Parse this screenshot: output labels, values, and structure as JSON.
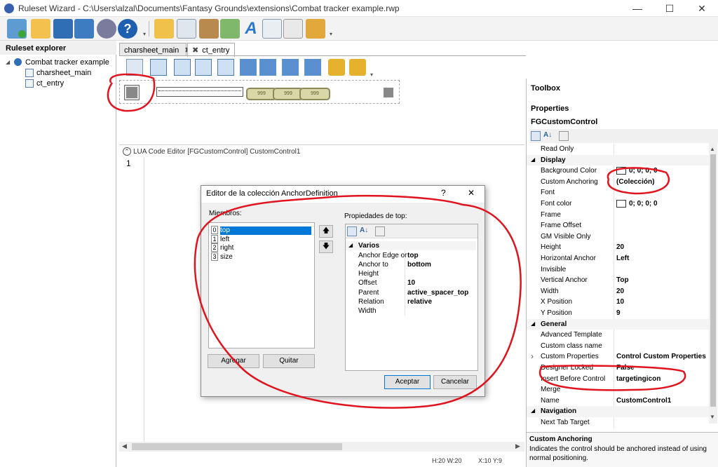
{
  "window": {
    "title": "Ruleset Wizard - C:\\Users\\alzal\\Documents\\Fantasy Grounds\\extensions\\Combat tracker example.rwp"
  },
  "icons": {
    "app": "ruleset-wizard-logo-icon",
    "minimize": "minimize-icon",
    "maximize": "maximize-icon",
    "close": "close-icon"
  },
  "toolbar": {
    "items": [
      "new-ruleset-icon",
      "open-folder-icon",
      "save-icon",
      "save-as-icon",
      "settings-icon",
      "help-icon",
      "add-folder-icon",
      "add-window-icon",
      "add-frame-icon",
      "add-image-icon",
      "add-font-icon",
      "add-script-icon",
      "add-string-icon",
      "add-package-icon"
    ]
  },
  "explorer": {
    "title": "Ruleset explorer",
    "root": "Combat tracker example",
    "items": [
      "charsheet_main",
      "ct_entry"
    ]
  },
  "tabs": [
    {
      "label": "charsheet_main",
      "close": "✖"
    },
    {
      "label": "ct_entry",
      "close": "✖"
    }
  ],
  "design_toolbar": {
    "items": [
      "new-control-icon",
      "bring-front-icon",
      "send-back-icon",
      "align-left-icon",
      "align-right-icon",
      "align-top-icon",
      "align-bottom-icon",
      "same-width-icon",
      "same-height-icon",
      "lock-icon",
      "unlock-icon"
    ]
  },
  "canvas": {
    "pills": [
      "999",
      "999",
      "999"
    ]
  },
  "lua": {
    "header": "LUA Code Editor [FGCustomControl] CustomControl1",
    "line1": "1",
    "collapse": "⌃"
  },
  "status": {
    "size": "H:20  W:20",
    "pos": "X:10  Y:9"
  },
  "right": {
    "toolbox": "Toolbox",
    "properties": "Properties",
    "object": "FGCustomControl",
    "rows": [
      {
        "n": "Read Only",
        "v": "",
        "cat": false
      },
      {
        "n": "Display",
        "v": "",
        "cat": true
      },
      {
        "n": "Background Color",
        "v": "0; 0; 0; 0",
        "cat": false,
        "swatch": true
      },
      {
        "n": "Custom Anchoring",
        "v": "(Colección)",
        "cat": false
      },
      {
        "n": "Font",
        "v": "",
        "cat": false
      },
      {
        "n": "Font color",
        "v": "0; 0; 0; 0",
        "cat": false,
        "swatch": true
      },
      {
        "n": "Frame",
        "v": "",
        "cat": false
      },
      {
        "n": "Frame Offset",
        "v": "",
        "cat": false
      },
      {
        "n": "GM Visible Only",
        "v": "",
        "cat": false
      },
      {
        "n": "Height",
        "v": "20",
        "cat": false
      },
      {
        "n": "Horizontal Anchor",
        "v": "Left",
        "cat": false
      },
      {
        "n": "Invisible",
        "v": "",
        "cat": false
      },
      {
        "n": "Vertical Anchor",
        "v": "Top",
        "cat": false
      },
      {
        "n": "Width",
        "v": "20",
        "cat": false
      },
      {
        "n": "X Position",
        "v": "10",
        "cat": false
      },
      {
        "n": "Y Position",
        "v": "9",
        "cat": false
      },
      {
        "n": "General",
        "v": "",
        "cat": true
      },
      {
        "n": "Advanced Template",
        "v": "",
        "cat": false
      },
      {
        "n": "Custom class name",
        "v": "",
        "cat": false
      },
      {
        "n": "Custom Properties",
        "v": "Control Custom Properties",
        "cat": false,
        "expand": true
      },
      {
        "n": "Designer Locked",
        "v": "False",
        "cat": false
      },
      {
        "n": "Insert Before Control",
        "v": "targetingicon",
        "cat": false
      },
      {
        "n": "Merge",
        "v": "",
        "cat": false
      },
      {
        "n": "Name",
        "v": "CustomControl1",
        "cat": false
      },
      {
        "n": "Navigation",
        "v": "",
        "cat": true
      },
      {
        "n": "Next Tab Target",
        "v": "",
        "cat": false
      }
    ],
    "desc_title": "Custom Anchoring",
    "desc_text": "Indicates the control should be anchored instead of using normal positioning."
  },
  "dialog": {
    "title": "Editor de la colección AnchorDefinition",
    "help": "?",
    "close": "✕",
    "members_label": "Miembros:",
    "members": [
      {
        "i": "0",
        "n": "top"
      },
      {
        "i": "1",
        "n": "left"
      },
      {
        "i": "2",
        "n": "right"
      },
      {
        "i": "3",
        "n": "size"
      }
    ],
    "up": "🡅",
    "down": "🡇",
    "props_label": "Propiedades de top:",
    "category": "Varios",
    "props": [
      {
        "n": "Anchor Edge or",
        "v": "top"
      },
      {
        "n": "Anchor to",
        "v": "bottom"
      },
      {
        "n": "Height",
        "v": ""
      },
      {
        "n": "Offset",
        "v": "10"
      },
      {
        "n": "Parent",
        "v": "active_spacer_top"
      },
      {
        "n": "Relation",
        "v": "relative"
      },
      {
        "n": "Width",
        "v": ""
      }
    ],
    "add": "Agregar",
    "remove": "Quitar",
    "ok": "Aceptar",
    "cancel": "Cancelar"
  },
  "colors": {
    "annotation": "#e0141e",
    "accent": "#0078d7"
  }
}
